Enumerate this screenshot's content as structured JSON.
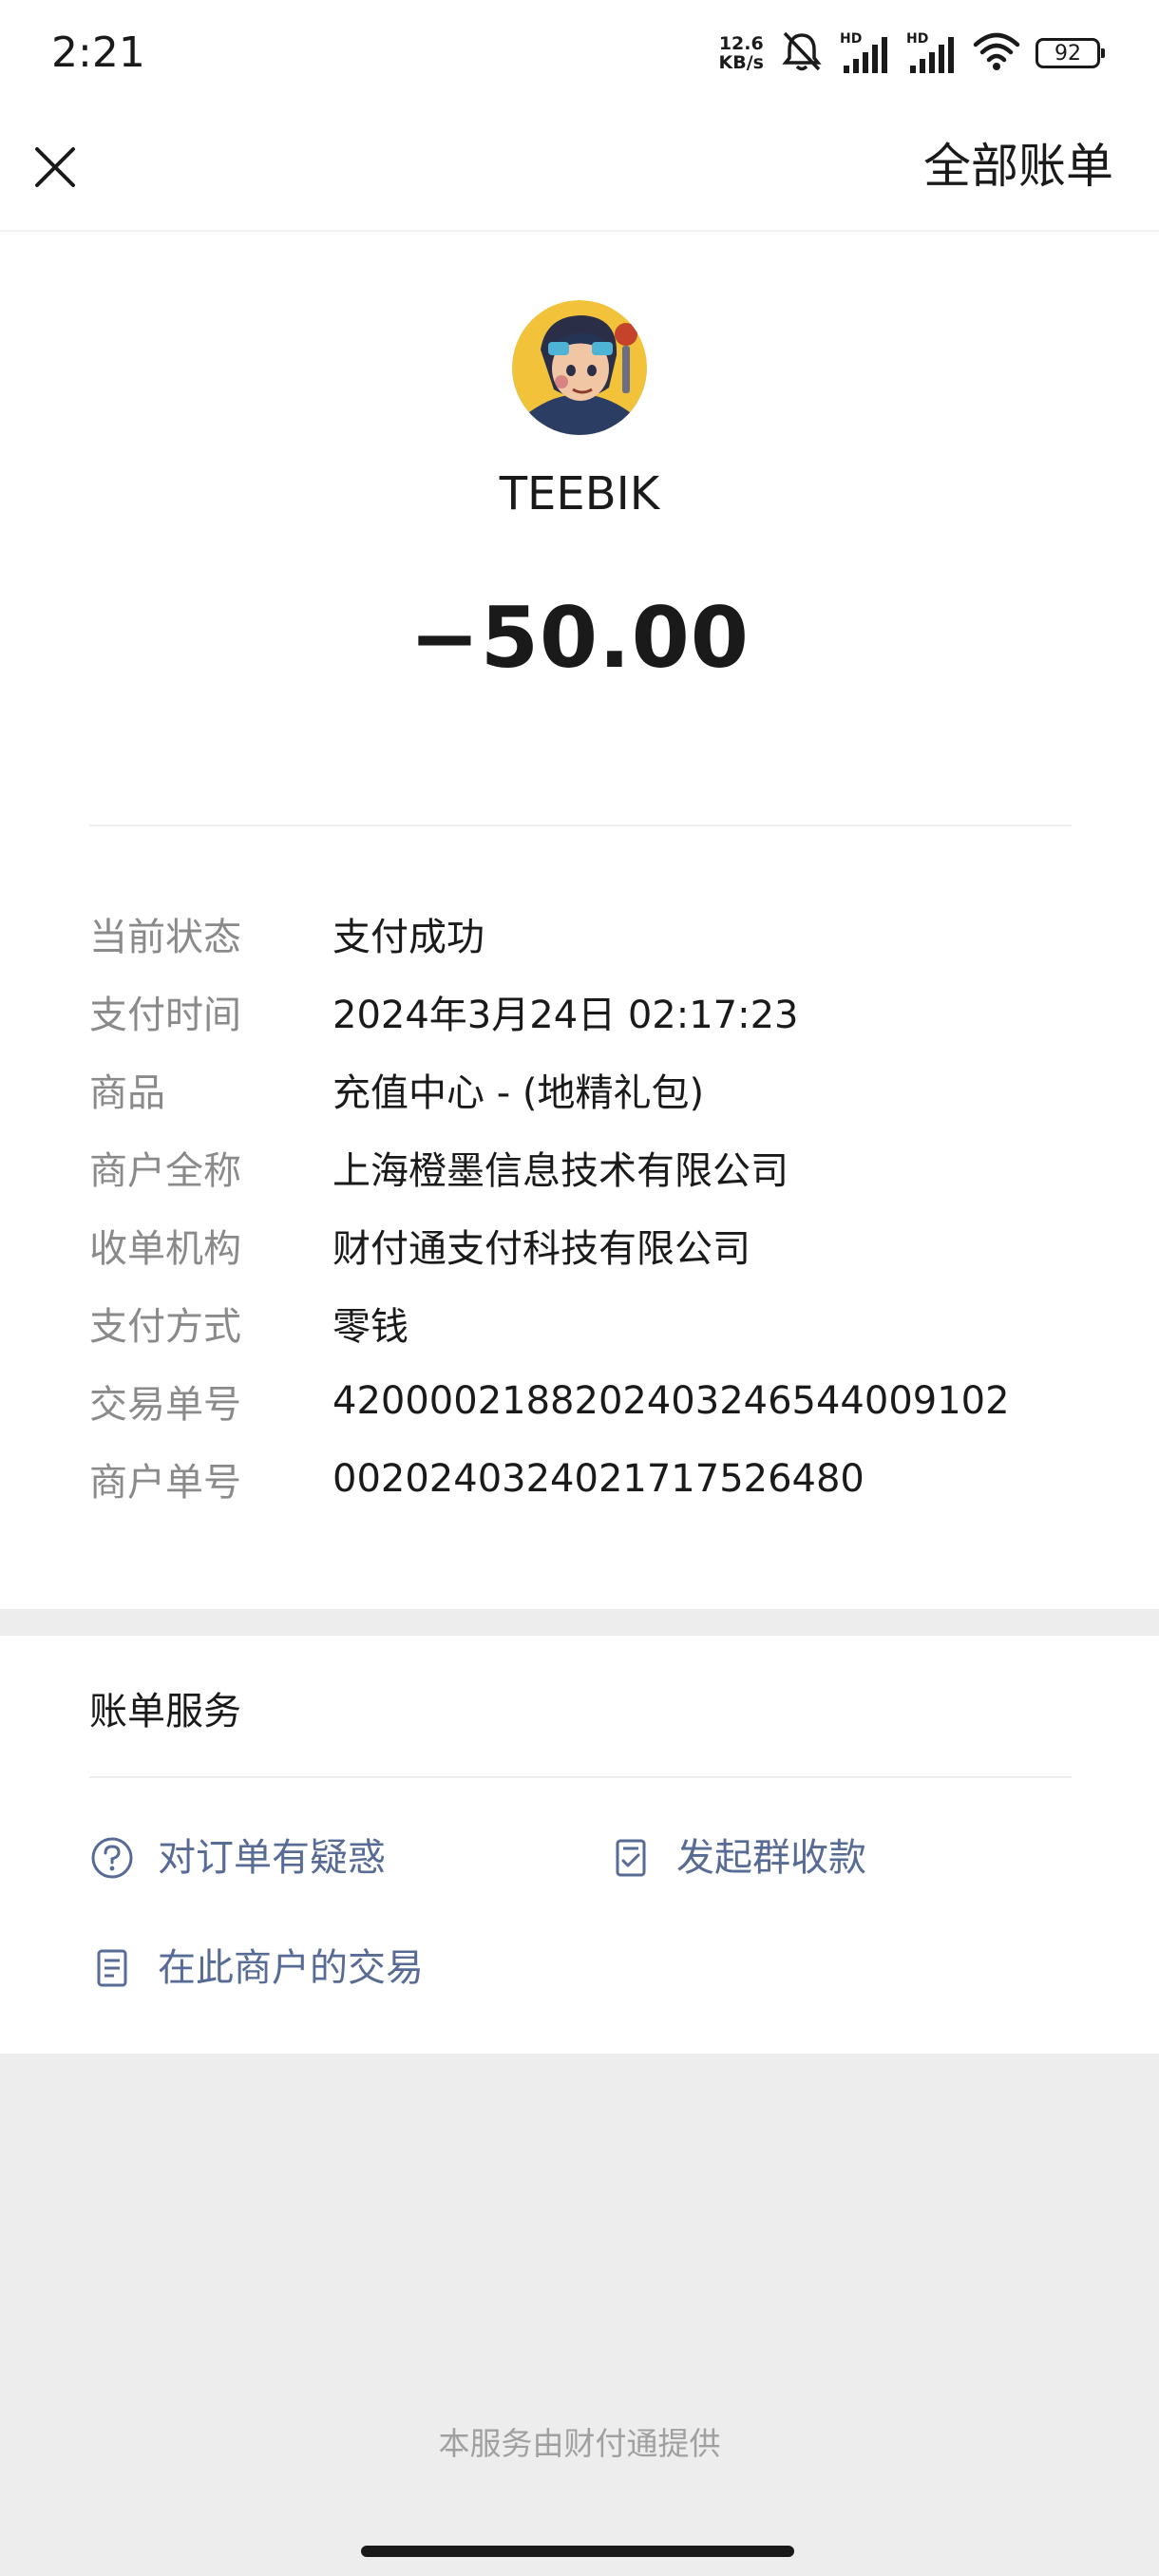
{
  "status_bar": {
    "time": "2:21",
    "net_speed_value": "12.6",
    "net_speed_unit": "KB/s",
    "signal_1_tag": "HD",
    "signal_2_tag": "HD",
    "battery": "92"
  },
  "nav": {
    "close_icon": "close-icon",
    "all_bills_label": "全部账单"
  },
  "merchant": {
    "name": "TEEBIK",
    "amount": "−50.00"
  },
  "details": [
    {
      "label": "当前状态",
      "value": "支付成功"
    },
    {
      "label": "支付时间",
      "value": "2024年3月24日 02:17:23"
    },
    {
      "label": "商品",
      "value": "充值中心 - (地精礼包)"
    },
    {
      "label": "商户全称",
      "value": "上海橙墨信息技术有限公司"
    },
    {
      "label": "收单机构",
      "value": "财付通支付科技有限公司"
    },
    {
      "label": "支付方式",
      "value": "零钱"
    },
    {
      "label": "交易单号",
      "value": "4200002188202403246544009102"
    },
    {
      "label": "商户单号",
      "value": "002024032402171752648​0"
    }
  ],
  "service": {
    "title": "账单服务",
    "question_label": "对订单有疑惑",
    "group_collect_label": "发起群收款",
    "merchant_trades_label": "在此商户的交易"
  },
  "footer": {
    "provider_text": "本服务由财付通提供"
  },
  "colors": {
    "link": "#576b95",
    "label_gray": "#8a8a8a",
    "page_bg": "#ededed"
  }
}
